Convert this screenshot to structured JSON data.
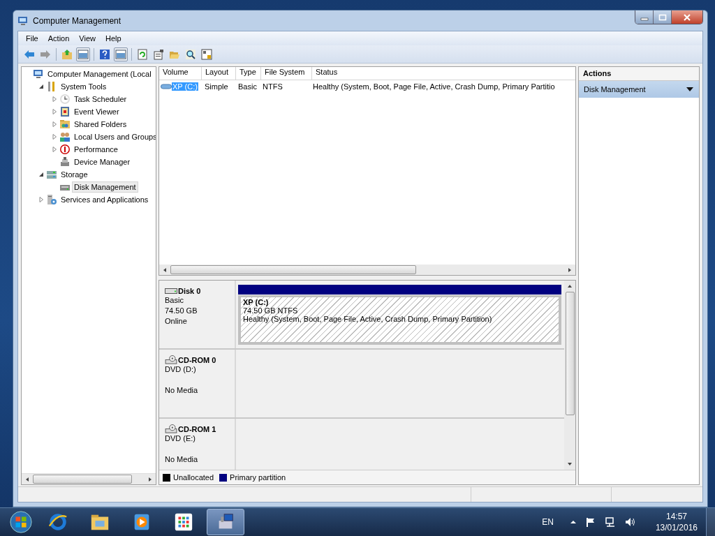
{
  "window": {
    "title": "Computer Management"
  },
  "menu": [
    "File",
    "Action",
    "View",
    "Help"
  ],
  "tree": {
    "items": [
      {
        "label": "Computer Management (Local",
        "selected": false,
        "children": [
          {
            "label": "System Tools",
            "expanded": true,
            "selected": false,
            "children": [
              {
                "label": "Task Scheduler",
                "expanded": false,
                "selected": false
              },
              {
                "label": "Event Viewer",
                "expanded": false,
                "selected": false
              },
              {
                "label": "Shared Folders",
                "expanded": false,
                "selected": false
              },
              {
                "label": "Local Users and Groups",
                "expanded": false,
                "selected": false
              },
              {
                "label": "Performance",
                "expanded": false,
                "selected": false
              },
              {
                "label": "Device Manager",
                "selected": false
              }
            ]
          },
          {
            "label": "Storage",
            "expanded": true,
            "selected": false,
            "children": [
              {
                "label": "Disk Management",
                "selected": true
              }
            ]
          },
          {
            "label": "Services and Applications",
            "expanded": false,
            "selected": false
          }
        ]
      }
    ]
  },
  "volume_table": {
    "columns": [
      "Volume",
      "Layout",
      "Type",
      "File System",
      "Status"
    ],
    "rows": [
      {
        "selected": true,
        "cells": [
          "XP (C:)",
          "Simple",
          "Basic",
          "NTFS",
          "Healthy (System, Boot, Page File, Active, Crash Dump, Primary Partitio"
        ]
      }
    ]
  },
  "disks": [
    {
      "kind": "disk",
      "name": "Disk 0",
      "type": "Basic",
      "size": "74.50 GB",
      "state": "Online",
      "partitions": [
        {
          "label": "XP  (C:)",
          "size": "74.50 GB NTFS",
          "status": "Healthy (System, Boot, Page File, Active, Crash Dump, Primary Partition)",
          "selected": true,
          "color": "#000080"
        }
      ]
    },
    {
      "kind": "cdrom",
      "name": "CD-ROM 0",
      "type": "DVD (D:)",
      "state": "No Media"
    },
    {
      "kind": "cdrom",
      "name": "CD-ROM 1",
      "type": "DVD (E:)",
      "state": "No Media"
    }
  ],
  "legend": [
    {
      "label": "Unallocated",
      "color": "#000000"
    },
    {
      "label": "Primary partition",
      "color": "#000080"
    }
  ],
  "actions": {
    "title": "Actions",
    "items": [
      {
        "label": "Disk Management"
      }
    ]
  },
  "taskbar": {
    "apps": [
      {
        "selected": false
      },
      {
        "selected": false
      },
      {
        "selected": false
      },
      {
        "selected": false
      },
      {
        "selected": true
      }
    ],
    "language": "EN",
    "time": "14:57",
    "date": "13/01/2016"
  }
}
